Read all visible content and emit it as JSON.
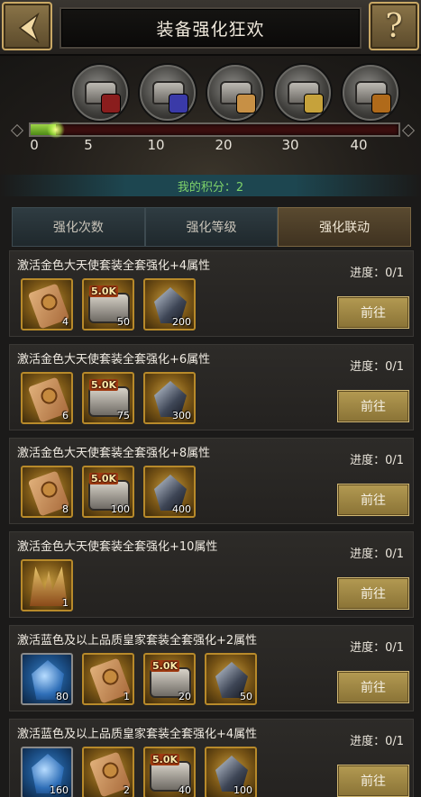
{
  "header": {
    "title": "装备强化狂欢",
    "help_label": "?"
  },
  "milestones": {
    "ticks": [
      "0",
      "5",
      "10",
      "20",
      "30",
      "40"
    ],
    "current_points": 2,
    "max_points": 40,
    "chests": [
      {
        "name": "milestone-chest-5",
        "icon": "chest-star-icon",
        "badge_color": "#8a1d1d"
      },
      {
        "name": "milestone-chest-10",
        "icon": "chest-book-icon",
        "badge_color": "#3a3aa8"
      },
      {
        "name": "milestone-chest-20",
        "icon": "chest-scroll-icon",
        "badge_color": "#c79045"
      },
      {
        "name": "milestone-chest-30",
        "icon": "chest-helmet-icon",
        "badge_color": "#c6a23b"
      },
      {
        "name": "milestone-chest-40",
        "icon": "chest-box-icon",
        "badge_color": "#b06a1a"
      }
    ]
  },
  "score": {
    "label": "我的积分：2"
  },
  "tabs": [
    {
      "label": "强化次数",
      "active": false
    },
    {
      "label": "强化等级",
      "active": false
    },
    {
      "label": "强化联动",
      "active": true
    }
  ],
  "tasks": [
    {
      "title": "激活金色大天使套装全套强化+4属性",
      "progress": "进度：0/1",
      "button": "前往",
      "rewards": [
        {
          "icon": "scroll-icon",
          "qty": "4",
          "tone": "gold"
        },
        {
          "icon": "chest-5k-icon",
          "label": "5.0K",
          "qty": "50",
          "tone": "gold"
        },
        {
          "icon": "crystal-icon",
          "qty": "200",
          "tone": "gold"
        }
      ]
    },
    {
      "title": "激活金色大天使套装全套强化+6属性",
      "progress": "进度：0/1",
      "button": "前往",
      "rewards": [
        {
          "icon": "scroll-icon",
          "qty": "6",
          "tone": "gold"
        },
        {
          "icon": "chest-5k-icon",
          "label": "5.0K",
          "qty": "75",
          "tone": "gold"
        },
        {
          "icon": "crystal-icon",
          "qty": "300",
          "tone": "gold"
        }
      ]
    },
    {
      "title": "激活金色大天使套装全套强化+8属性",
      "progress": "进度：0/1",
      "button": "前往",
      "rewards": [
        {
          "icon": "scroll-icon",
          "qty": "8",
          "tone": "gold"
        },
        {
          "icon": "chest-5k-icon",
          "label": "5.0K",
          "qty": "100",
          "tone": "gold"
        },
        {
          "icon": "crystal-icon",
          "qty": "400",
          "tone": "gold"
        }
      ]
    },
    {
      "title": "激活金色大天使套装全套强化+10属性",
      "progress": "进度：0/1",
      "button": "前往",
      "rewards": [
        {
          "icon": "wings-icon",
          "qty": "1",
          "tone": "gold"
        }
      ]
    },
    {
      "title": "激活蓝色及以上品质皇家套装全套强化+2属性",
      "progress": "进度：0/1",
      "button": "前往",
      "rewards": [
        {
          "icon": "blue-gem-icon",
          "qty": "80",
          "tone": "blue"
        },
        {
          "icon": "scroll-icon",
          "qty": "1",
          "tone": "gold"
        },
        {
          "icon": "chest-5k-icon",
          "label": "5.0K",
          "qty": "20",
          "tone": "gold"
        },
        {
          "icon": "crystal-icon",
          "qty": "50",
          "tone": "gold"
        }
      ]
    },
    {
      "title": "激活蓝色及以上品质皇家套装全套强化+4属性",
      "progress": "进度：0/1",
      "button": "前往",
      "rewards": [
        {
          "icon": "blue-gem-icon",
          "qty": "160",
          "tone": "blue"
        },
        {
          "icon": "scroll-icon",
          "qty": "2",
          "tone": "gold"
        },
        {
          "icon": "chest-5k-icon",
          "label": "5.0K",
          "qty": "40",
          "tone": "gold"
        },
        {
          "icon": "crystal-icon",
          "qty": "100",
          "tone": "gold"
        }
      ]
    }
  ]
}
